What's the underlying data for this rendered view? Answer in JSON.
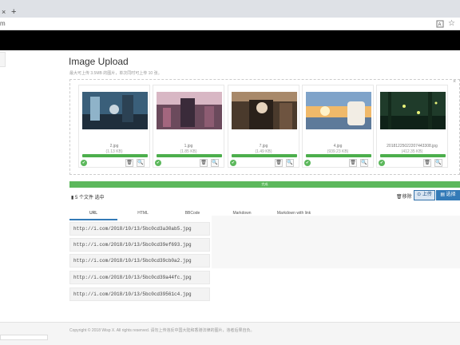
{
  "browser": {
    "tab_close": "×",
    "new_tab": "+",
    "address": "m",
    "translate_icon": "translate-icon",
    "star_icon": "star-icon"
  },
  "page": {
    "title": "Image Upload",
    "subtitle": "最大可上传 3.5MB 的图片，单次同时可上传 10 张。",
    "close_glyph": "×"
  },
  "thumbnails": [
    {
      "name": "2.jpg",
      "size": "(1.13 KB)"
    },
    {
      "name": "1.jpg",
      "size": "(1.85 KB)"
    },
    {
      "name": "7.jpg",
      "size": "(1.49 KB)"
    },
    {
      "name": "4.jpg",
      "size": "(939.23 KB)"
    },
    {
      "name": "20181225022207443308.jpg",
      "size": "(412.35 KB)"
    }
  ],
  "upload": {
    "progress_text": "完成",
    "progress_fraction": 1.0,
    "file_count": "5 个文件 选中",
    "clear_label": "移除",
    "upload_label": "上传",
    "browse_label": "选择"
  },
  "tabs": [
    "URL",
    "HTML",
    "BBCode",
    "Markdown",
    "Markdown with link"
  ],
  "links": [
    "http://i.com/2018/10/13/5bc0cd3a30ab5.jpg",
    "http://i.com/2018/10/13/5bc0cd39ef693.jpg",
    "http://i.com/2018/10/13/5bc0cd39cb0a2.jpg",
    "http://i.com/2018/10/13/5bc0cd39a44fc.jpg",
    "http://i.com/2018/10/13/5bc0cd39561c4.jpg"
  ],
  "footer": "Copyright © 2018 Wisp X. All rights reserved. 请勿上传违反中国大陆和香港法律的图片，违者后果自负。",
  "colors": {
    "success": "#5cb85c",
    "primary": "#337ab7",
    "navbar": "#000000"
  }
}
